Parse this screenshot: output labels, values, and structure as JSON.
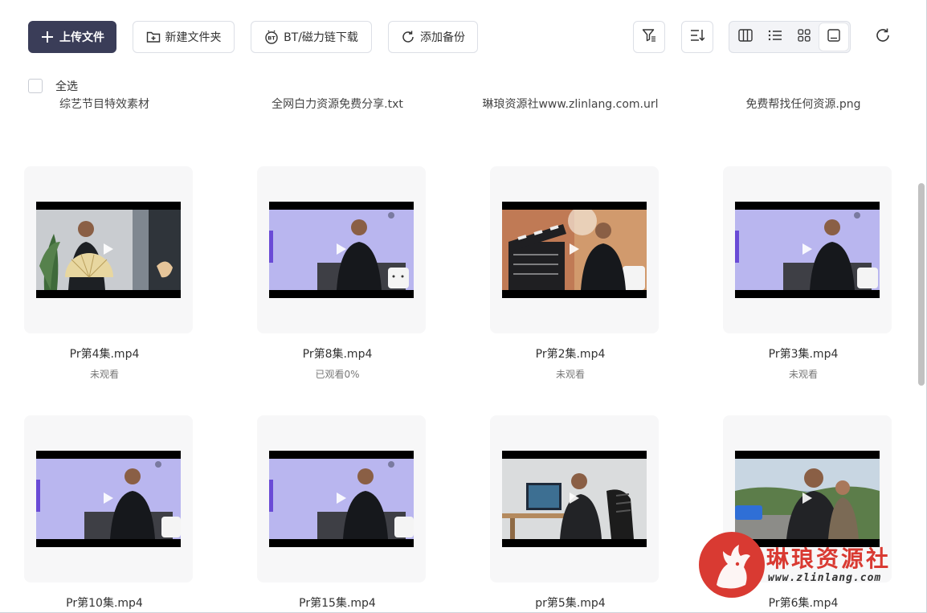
{
  "toolbar": {
    "upload_label": "上传文件",
    "new_folder_label": "新建文件夹",
    "bt_label": "BT/磁力链下载",
    "backup_label": "添加备份"
  },
  "select_all_label": "全选",
  "previous_row": [
    {
      "name": "综艺节目特效素材"
    },
    {
      "name": "全网白力资源免费分享.txt"
    },
    {
      "name": "琳琅资源社www.zlinlang.com.url"
    },
    {
      "name": "免费帮找任何资源.png"
    }
  ],
  "files": [
    {
      "name": "Pr第4集.mp4",
      "status": "未观看",
      "scene": "fan"
    },
    {
      "name": "Pr第8集.mp4",
      "status": "已观看0%",
      "scene": "studio"
    },
    {
      "name": "Pr第2集.mp4",
      "status": "未观看",
      "scene": "clapper"
    },
    {
      "name": "Pr第3集.mp4",
      "status": "未观看",
      "scene": "studio"
    },
    {
      "name": "Pr第10集.mp4",
      "status": "",
      "scene": "studio"
    },
    {
      "name": "Pr第15集.mp4",
      "status": "",
      "scene": "studio"
    },
    {
      "name": "pr第5集.mp4",
      "status": "",
      "scene": "office"
    },
    {
      "name": "Pr第6集.mp4",
      "status": "",
      "scene": "outdoor"
    }
  ],
  "watermark": {
    "title": "琳琅资源社",
    "url": "www.zlinlang.com"
  },
  "colors": {
    "primary_button": "#3a3d58",
    "card_bg": "#f7f7f8",
    "studio_bg": "#b9b6ef",
    "watermark_red": "#d93a32"
  }
}
